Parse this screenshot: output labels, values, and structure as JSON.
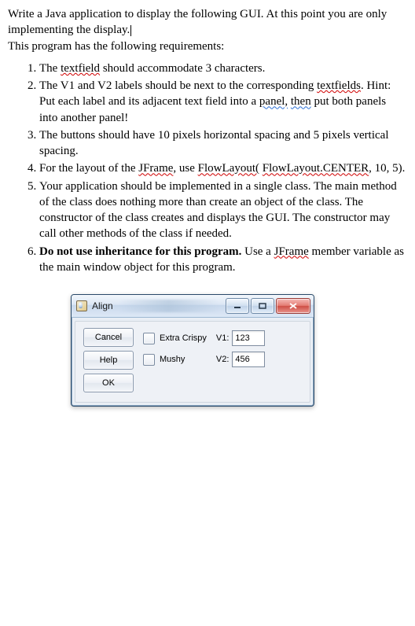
{
  "intro": {
    "line1a": "Write a Java application to display the following GUI. At this point you are",
    "line1b": "only implementing the display.",
    "line2": "This program has the following requirements:"
  },
  "reqs": {
    "r1a": "The ",
    "r1b": "textfield",
    "r1c": " should accommodate 3 characters.",
    "r2a": "The V1 and V2 labels should be next to the corresponding ",
    "r2b": "textfields",
    "r2c": ". Hint: Put each label and its adjacent text field into a ",
    "r2d": "panel,",
    "r2e": " ",
    "r2f": "then",
    "r2g": " put both panels into another panel!",
    "r3": "The buttons should have 10 pixels horizontal spacing and 5 pixels vertical spacing.",
    "r4a": "For the layout of the ",
    "r4b": "JFrame",
    "r4c": ", use ",
    "r4d": "FlowLayout(",
    "r4e": " ",
    "r4f": "FlowLayout.CENTER",
    "r4g": ", 10, 5).",
    "r5a": "Your application should be implemented in a single class. The main method of the class does nothing more than create an object of the class. The constructor of the class creates and displays the GUI. The constructor may call other methods of the class if needed.",
    "r6a": "Do not use inheritance for this program.",
    "r6b": " Use a ",
    "r6c": "JFrame",
    "r6d": " member variable as the main window object for this program."
  },
  "gui": {
    "title": "Align",
    "buttons": {
      "cancel": "Cancel",
      "help": "Help",
      "ok": "OK"
    },
    "checks": {
      "extra": "Extra Crispy",
      "mushy": "Mushy"
    },
    "fields": {
      "v1label": "V1:",
      "v1value": "123",
      "v2label": "V2:",
      "v2value": "456"
    }
  }
}
